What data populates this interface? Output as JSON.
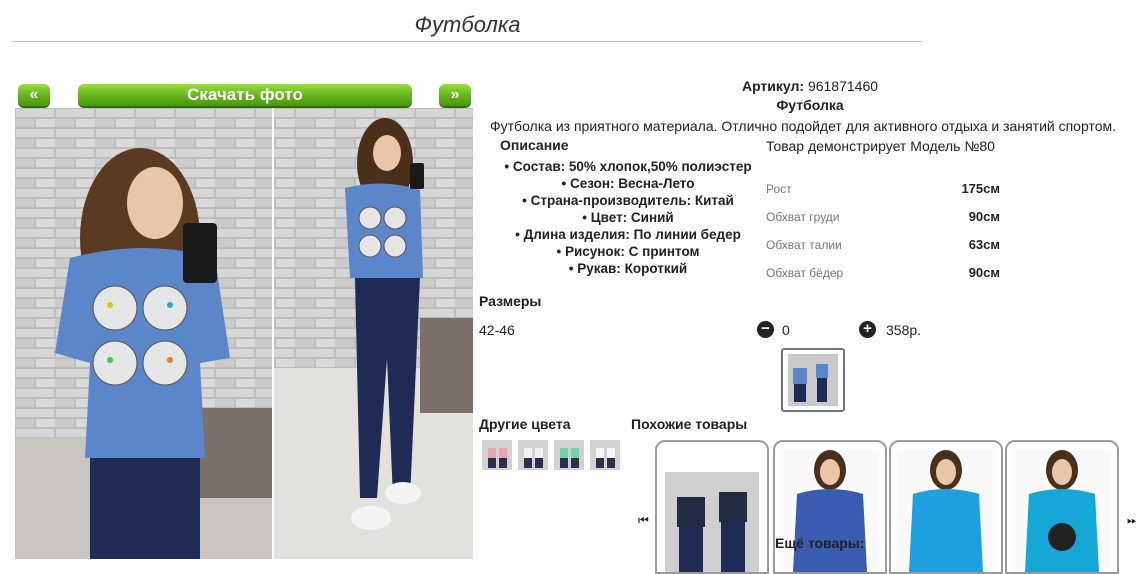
{
  "header": {
    "title": "Футболка"
  },
  "photo_nav": {
    "prev": "«",
    "download": "Скачать фото",
    "next": "»"
  },
  "product": {
    "article_label": "Артикул:",
    "article_value": "961871460",
    "name": "Футболка",
    "description": "Футболка из приятного материала. Отлично подойдет для активного отдыха и занятий спортом.",
    "description_heading": "Описание",
    "attributes": [
      "Состав: 50% хлопок,50% полиэстер",
      "Сезон: Весна-Лето",
      "Страна-производитель: Китай",
      "Цвет: Синий",
      "Длина изделия: По линии бедер",
      "Рисунок: С принтом",
      "Рукав: Короткий"
    ]
  },
  "model": {
    "text": "Товар демонстрирует Модель №80",
    "measurements": [
      {
        "label": "Рост",
        "value": "175см"
      },
      {
        "label": "Обхват груди",
        "value": "90см"
      },
      {
        "label": "Обхват талии",
        "value": "63см"
      },
      {
        "label": "Обхват бёдер",
        "value": "90см"
      }
    ]
  },
  "sizes": {
    "heading": "Размеры",
    "size": "42-46",
    "minus": "−",
    "quantity": "0",
    "plus": "+",
    "price": "358р."
  },
  "other_colors": {
    "heading": "Другие цвета"
  },
  "similar": {
    "heading": "Похожие товары",
    "left_arrow": "⏮",
    "right_arrow": "⏭",
    "more": "Ещё товары:"
  },
  "colors": {
    "accent_green": "#62b21b",
    "shirt_blue": "#5b86c9",
    "card_border": "#9a9a9a"
  },
  "icons": [
    "minus-circle-icon",
    "plus-circle-icon",
    "carousel-left-icon",
    "carousel-right-icon"
  ]
}
